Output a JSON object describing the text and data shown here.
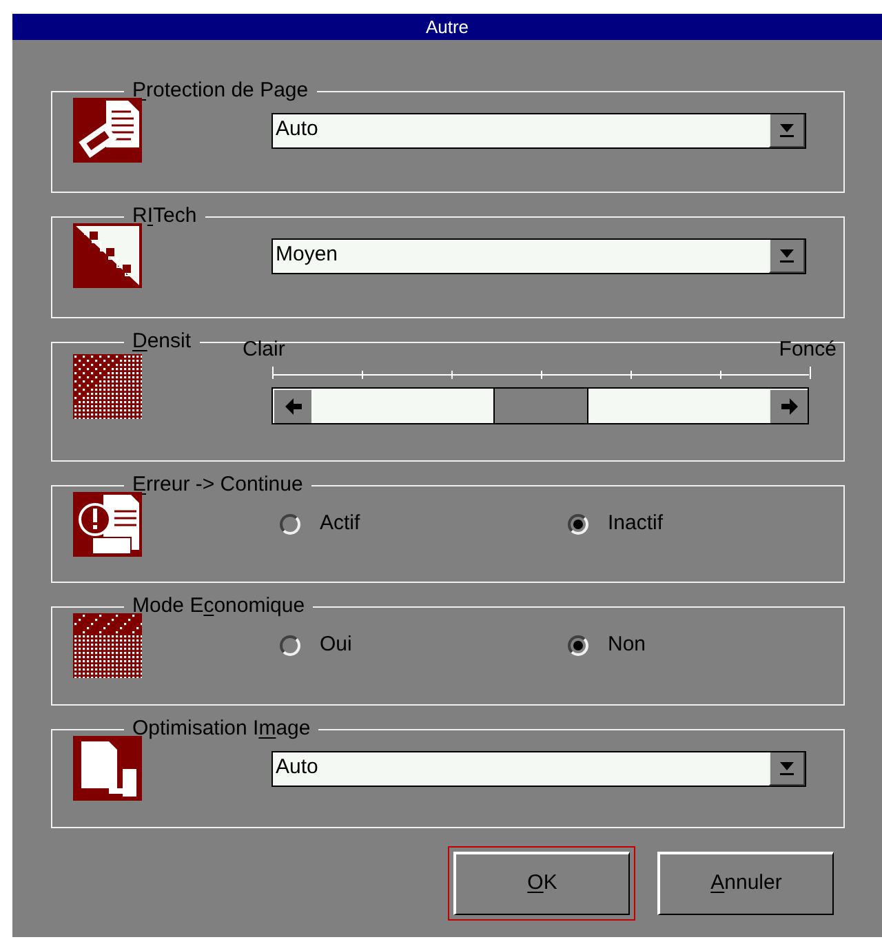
{
  "window": {
    "title": "Autre"
  },
  "sections": [
    {
      "kind": "dropdown",
      "title": {
        "key": "P",
        "after": "rotection de Page"
      },
      "value": "Auto"
    },
    {
      "kind": "dropdown",
      "title": {
        "before": "R",
        "key": "I",
        "after": "Tech"
      },
      "value": "Moyen"
    },
    {
      "kind": "slider",
      "title": {
        "key": "D",
        "after": "ensit"
      },
      "min_label": "Clair",
      "max_label": "Foncé",
      "level": 0.5
    },
    {
      "kind": "radio",
      "title": {
        "key": "E",
        "after": "rreur -> Continue"
      },
      "options": [
        {
          "label": "Actif",
          "selected": false
        },
        {
          "label": "Inactif",
          "selected": true
        }
      ]
    },
    {
      "kind": "radio",
      "title": {
        "before": "Mode E",
        "key": "c",
        "after": "onomique"
      },
      "options": [
        {
          "label": "Oui",
          "selected": false
        },
        {
          "label": "Non",
          "selected": true
        }
      ]
    },
    {
      "kind": "dropdown",
      "title": {
        "before": "Optimisation I",
        "key": "m",
        "after": "age"
      },
      "value": "Auto"
    }
  ],
  "buttons": [
    {
      "label": {
        "key": "O",
        "after": "K"
      },
      "default": true
    },
    {
      "label": {
        "key": "A",
        "after": "nnuler"
      },
      "default": false
    }
  ]
}
